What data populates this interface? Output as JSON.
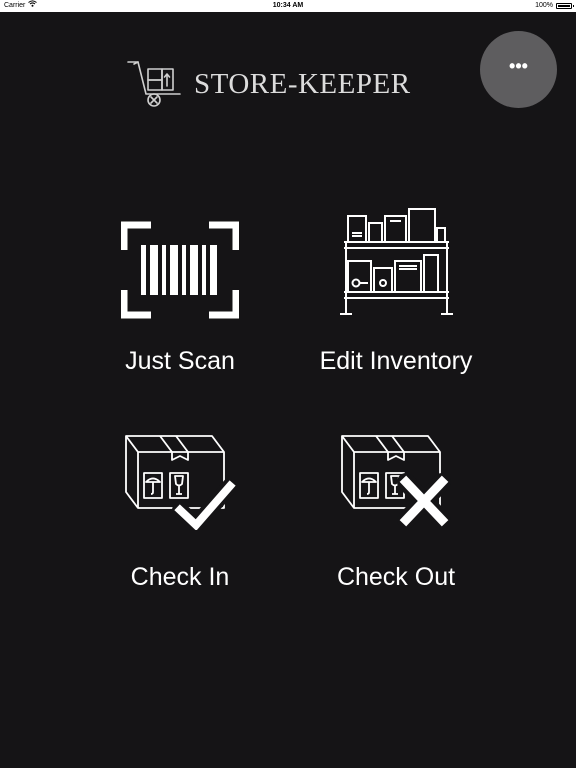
{
  "status_bar": {
    "carrier": "Carrier",
    "time": "10:34 AM",
    "battery": "100%",
    "battery_level": 1.0
  },
  "header": {
    "app_title": "STORE-KEEPER",
    "logo_icon": "hand-truck-icon",
    "more_button_label": "•••"
  },
  "actions": [
    {
      "label": "Just Scan",
      "icon": "barcode-scan-icon"
    },
    {
      "label": "Edit Inventory",
      "icon": "inventory-shelf-icon"
    },
    {
      "label": "Check In",
      "icon": "box-check-icon"
    },
    {
      "label": "Check Out",
      "icon": "box-cross-icon"
    }
  ],
  "colors": {
    "background": "#151416",
    "text": "#ffffff",
    "more_button": "#5e5d5f",
    "logo_text": "#dcdcdc"
  }
}
